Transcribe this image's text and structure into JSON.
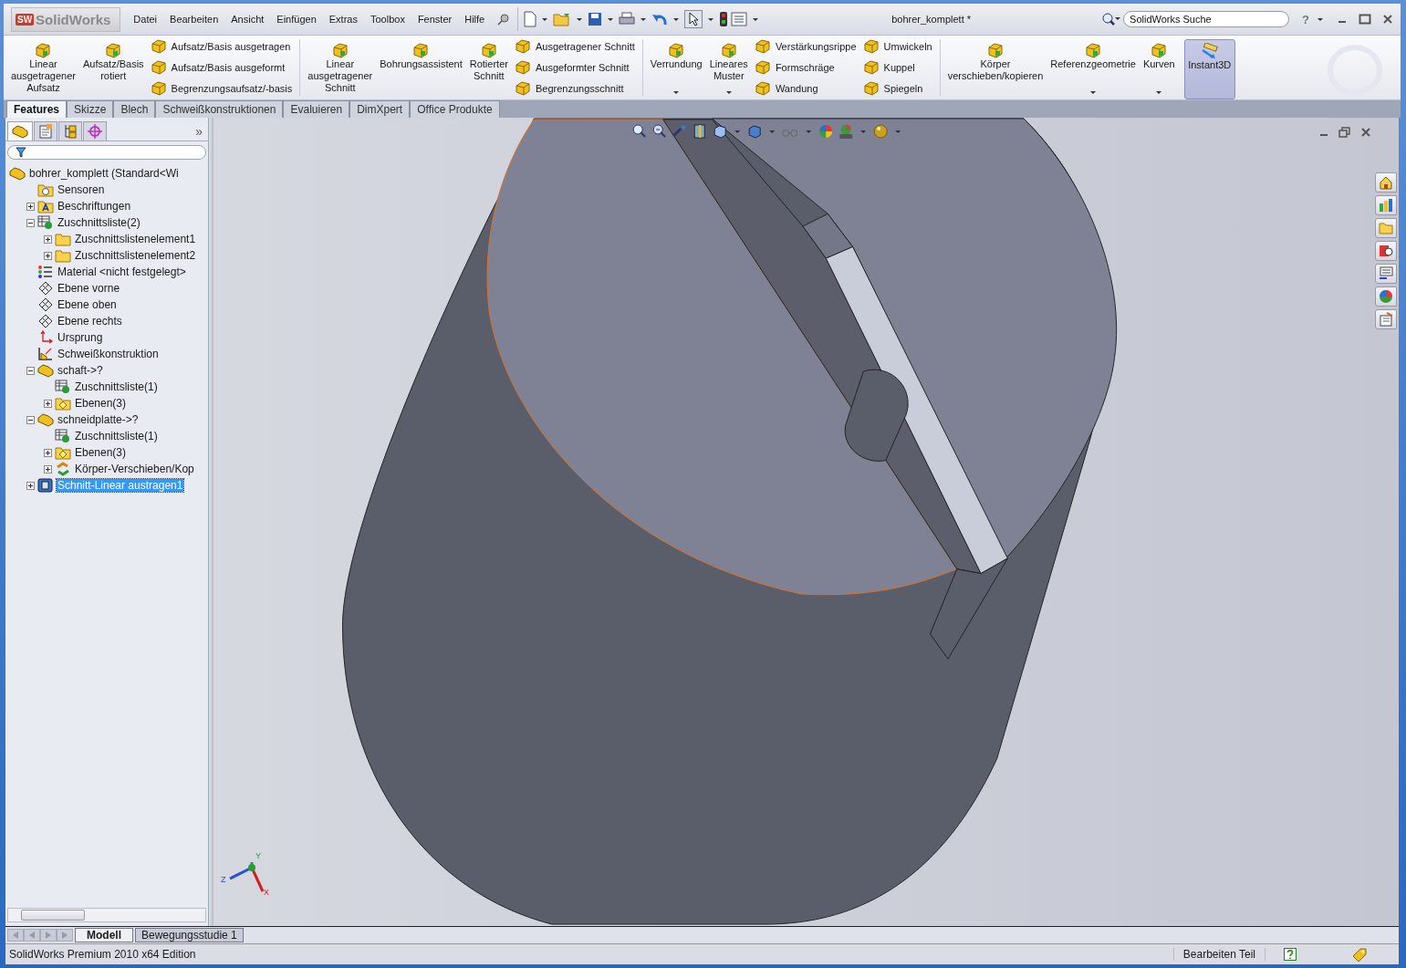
{
  "app": {
    "logo_badge": "SW",
    "logo": "SolidWorks"
  },
  "menu": [
    "Datei",
    "Bearbeiten",
    "Ansicht",
    "Einfügen",
    "Extras",
    "Toolbox",
    "Fenster",
    "Hilfe"
  ],
  "document_title": "bohrer_komplett *",
  "search": {
    "placeholder": "SolidWorks Suche"
  },
  "help": "?",
  "ribbon": [
    {
      "items": [
        {
          "kind": "large",
          "label": "Linear\nausgetragener\nAufsatz"
        },
        {
          "kind": "large",
          "label": "Aufsatz/Basis\nrotiert"
        },
        {
          "kind": "stack",
          "entries": [
            "Aufsatz/Basis ausgetragen",
            "Aufsatz/Basis ausgeformt",
            "Begrenzungsaufsatz/-basis"
          ]
        }
      ]
    },
    {
      "items": [
        {
          "kind": "large",
          "label": "Linear\nausgetragener\nSchnitt"
        },
        {
          "kind": "large",
          "label": "Bohrungsassistent"
        },
        {
          "kind": "large",
          "label": "Rotierter\nSchnitt"
        },
        {
          "kind": "stack",
          "entries": [
            "Ausgetragener Schnitt",
            "Ausgeformter Schnitt",
            "Begrenzungsschnitt"
          ]
        }
      ]
    },
    {
      "items": [
        {
          "kind": "large",
          "label": "Verrundung",
          "dropdown": true
        },
        {
          "kind": "large",
          "label": "Lineares\nMuster",
          "dropdown": true
        },
        {
          "kind": "stack",
          "entries": [
            "Verstärkungsrippe",
            "Formschräge",
            "Wandung"
          ]
        },
        {
          "kind": "stack",
          "entries": [
            "Umwickeln",
            "Kuppel",
            "Spiegeln"
          ]
        }
      ]
    },
    {
      "items": [
        {
          "kind": "large",
          "label": "Körper\nverschieben/kopieren"
        },
        {
          "kind": "large",
          "label": "Referenzgeometrie",
          "dropdown": true
        },
        {
          "kind": "large",
          "label": "Kurven",
          "dropdown": true
        }
      ]
    },
    {
      "items": [
        {
          "kind": "toggle",
          "label": "Instant3D",
          "on": true
        }
      ]
    }
  ],
  "command_tabs": [
    {
      "label": "Features",
      "selected": true
    },
    {
      "label": "Skizze",
      "selected": false
    },
    {
      "label": "Blech",
      "selected": false
    },
    {
      "label": "Schweißkonstruktionen",
      "selected": false
    },
    {
      "label": "Evaluieren",
      "selected": false
    },
    {
      "label": "DimXpert",
      "selected": false
    },
    {
      "label": "Office Produkte",
      "selected": false
    }
  ],
  "panel_tabs": [
    {
      "kind": "tree",
      "selected": true
    },
    {
      "kind": "property",
      "selected": false
    },
    {
      "kind": "config",
      "selected": false
    },
    {
      "kind": "dimxpert",
      "selected": false
    }
  ],
  "panel_more": "»",
  "tree": {
    "label": "bohrer_komplett  (Standard<Wi",
    "kind": "part",
    "selected": false,
    "children": [
      {
        "label": "Sensoren",
        "kind": "sensor",
        "selected": false
      },
      {
        "label": "Beschriftungen",
        "kind": "annotation",
        "expanded": false,
        "selected": false
      },
      {
        "label": "Zuschnittsliste(2)",
        "kind": "cutlist",
        "expanded": true,
        "selected": false,
        "children": [
          {
            "label": "Zuschnittslistenelement1",
            "kind": "folder",
            "expanded": false,
            "selected": false
          },
          {
            "label": "Zuschnittslistenelement2",
            "kind": "folder",
            "expanded": false,
            "selected": false
          }
        ]
      },
      {
        "label": "Material <nicht festgelegt>",
        "kind": "material",
        "selected": false
      },
      {
        "label": "Ebene vorne",
        "kind": "plane",
        "selected": false
      },
      {
        "label": "Ebene oben",
        "kind": "plane",
        "selected": false
      },
      {
        "label": "Ebene rechts",
        "kind": "plane",
        "selected": false
      },
      {
        "label": "Ursprung",
        "kind": "origin",
        "selected": false
      },
      {
        "label": "Schweißkonstruktion",
        "kind": "weldment",
        "selected": false
      },
      {
        "label": "schaft->?",
        "kind": "part",
        "expanded": true,
        "selected": false,
        "children": [
          {
            "label": "Zuschnittsliste(1)",
            "kind": "cutlist",
            "selected": false
          },
          {
            "label": "Ebenen(3)",
            "kind": "planes",
            "expanded": false,
            "selected": false
          }
        ]
      },
      {
        "label": "schneidplatte->?",
        "kind": "part",
        "expanded": true,
        "selected": false,
        "children": [
          {
            "label": "Zuschnittsliste(1)",
            "kind": "cutlist",
            "selected": false
          },
          {
            "label": "Ebenen(3)",
            "kind": "planes",
            "expanded": false,
            "selected": false
          },
          {
            "label": "Körper-Verschieben/Kop",
            "kind": "move",
            "expanded": false,
            "selected": false
          }
        ]
      },
      {
        "label": "Schnitt-Linear austragen1",
        "kind": "cut",
        "expanded": false,
        "selected": true
      }
    ]
  },
  "triad": {
    "x": "X",
    "y": "Y",
    "z": "Z"
  },
  "model_tabs": [
    {
      "label": "Modell",
      "selected": true
    },
    {
      "label": "Bewegungsstudie 1",
      "selected": false
    }
  ],
  "status_bar": {
    "edition": "SolidWorks Premium 2010 x64 Edition",
    "mode": "Bearbeiten Teil"
  }
}
